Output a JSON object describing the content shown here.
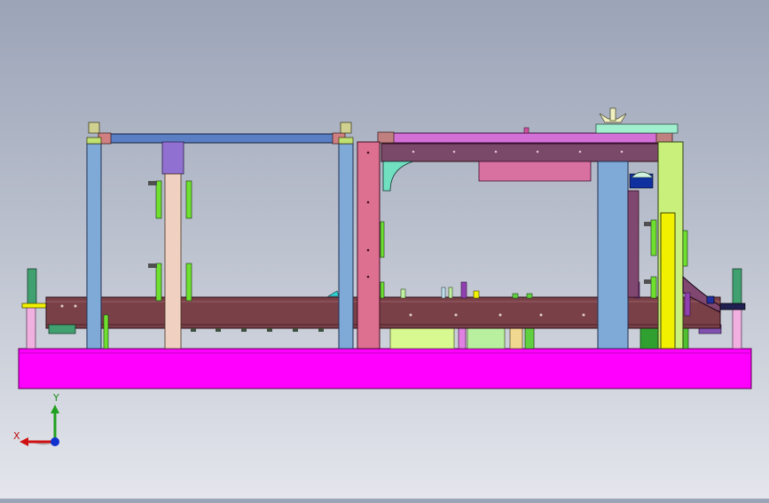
{
  "viewport": {
    "background_top": "#9ba4b8",
    "background_bottom": "#e4e6ec",
    "colors": {
      "base_plate": "#ff00ff",
      "main_beam": "#7a4048",
      "column_blue": "#7fa9d6",
      "top_bar_blue": "#5b7fc4",
      "top_bar_magenta": "#d270d6",
      "column_pink": "#dd7090",
      "column_lime": "#c8f07a",
      "column_yellow": "#f0f000",
      "clamp_green": "#70e030",
      "pad_purple": "#9070d0"
    }
  },
  "triad": {
    "x_label": "X",
    "y_label": "Y",
    "x_color": "#d01010",
    "y_color": "#20a020",
    "z_color": "#1030d0"
  }
}
